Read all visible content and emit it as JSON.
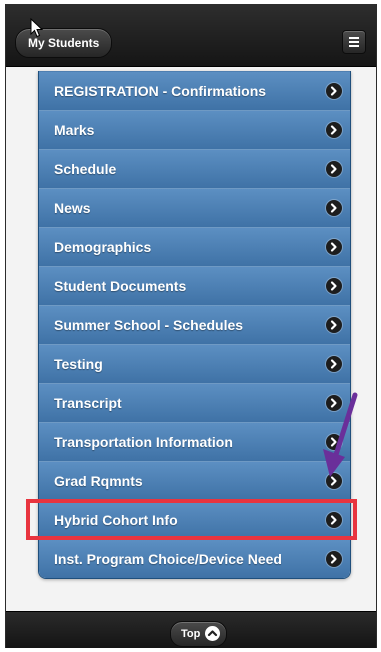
{
  "header": {
    "back_label": "My Students",
    "menu_icon": "hamburger-menu-icon"
  },
  "menu": {
    "items": [
      {
        "label": "REGISTRATION - Confirmations"
      },
      {
        "label": "Marks"
      },
      {
        "label": "Schedule"
      },
      {
        "label": "News"
      },
      {
        "label": "Demographics"
      },
      {
        "label": "Student Documents"
      },
      {
        "label": "Summer School - Schedules"
      },
      {
        "label": "Testing"
      },
      {
        "label": "Transcript"
      },
      {
        "label": "Transportation Information"
      },
      {
        "label": "Grad Rqmnts"
      },
      {
        "label": "Hybrid Cohort Info"
      },
      {
        "label": "Inst. Program Choice/Device Need"
      }
    ],
    "item_icon": "chevron-right-circle-icon"
  },
  "annotations": {
    "highlighted_item": "Hybrid Cohort Info",
    "highlight_color": "#e8343f",
    "arrow_color": "#6a2f9a"
  },
  "footer": {
    "top_label": "Top",
    "top_icon": "chevron-up-circle-icon"
  },
  "colors": {
    "header_bg": "#1c1c1c",
    "list_item_bg": "#4a7db1",
    "content_bg": "#f3f3f3"
  }
}
